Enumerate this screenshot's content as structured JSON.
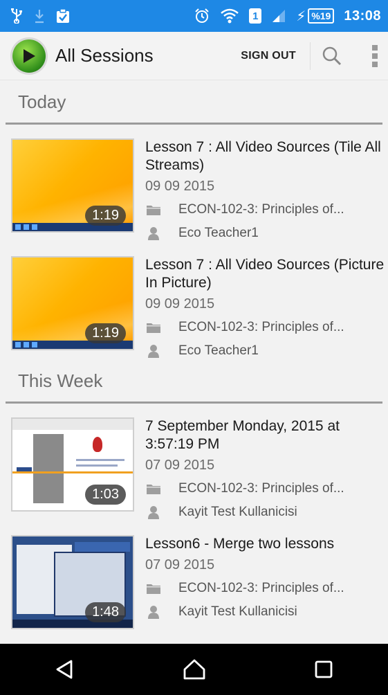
{
  "status_bar": {
    "battery_level": "%19",
    "sim_slot": "1",
    "time": "13:08"
  },
  "toolbar": {
    "title": "All Sessions",
    "sign_out_label": "SIGN OUT"
  },
  "sections": [
    {
      "header": "Today",
      "sessions": [
        {
          "title": "Lesson 7 : All Video Sources (Tile All Streams)",
          "date": "09 09 2015",
          "course": "ECON-102-3: Principles of...",
          "teacher": "Eco Teacher1",
          "duration": "1:19"
        },
        {
          "title": "Lesson 7 : All Video Sources (Picture In Picture)",
          "date": "09 09 2015",
          "course": "ECON-102-3: Principles of...",
          "teacher": "Eco Teacher1",
          "duration": "1:19"
        }
      ]
    },
    {
      "header": "This Week",
      "sessions": [
        {
          "title": "7 September Monday, 2015 at 3:57:19 PM",
          "date": "07 09 2015",
          "course": "ECON-102-3: Principles of...",
          "teacher": "Kayit Test Kullanicisi",
          "duration": "1:03"
        },
        {
          "title": "Lesson6 - Merge two lessons",
          "date": "07 09 2015",
          "course": "ECON-102-3: Principles of...",
          "teacher": "Kayit Test Kullanicisi",
          "duration": "1:48"
        }
      ]
    }
  ],
  "colors": {
    "status_bar": "#1e88e5",
    "background": "#f2f2f2",
    "accent_logo": "#4caf2a"
  }
}
